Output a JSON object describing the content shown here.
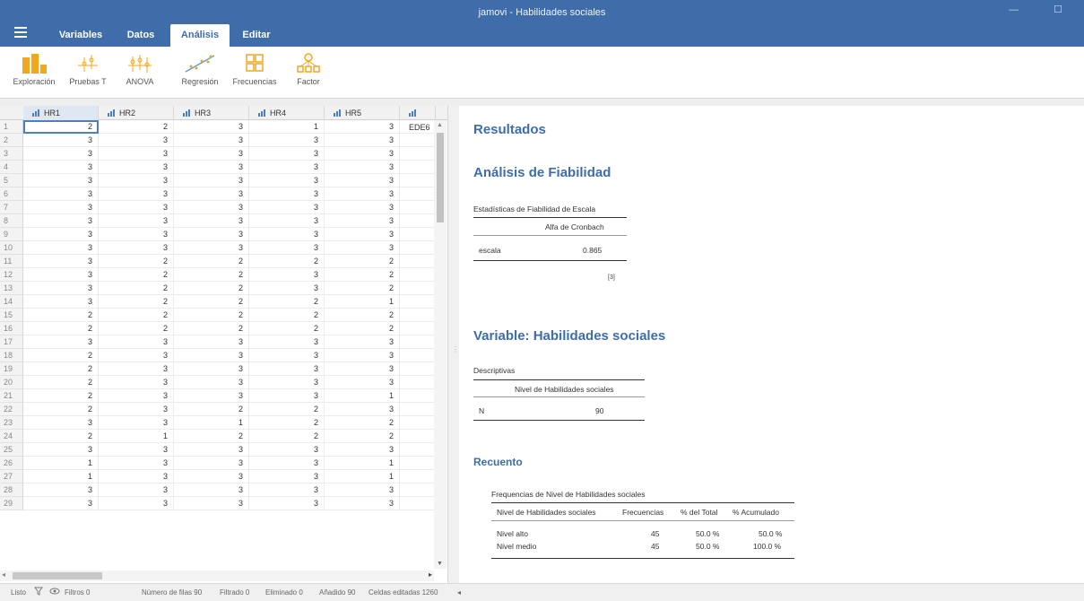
{
  "window": {
    "title": "jamovi - Habilidades sociales",
    "controls": "— ☐"
  },
  "tabs": [
    {
      "label": "Variables"
    },
    {
      "label": "Datos"
    },
    {
      "label": "Análisis"
    },
    {
      "label": "Editar"
    }
  ],
  "active_tab": "Análisis",
  "ribbon": {
    "exploracion": "Exploración",
    "pruebas_t": "Pruebas T",
    "anova": "ANOVA",
    "regresion": "Regresión",
    "frecuencias": "Frecuencias",
    "factor": "Factor"
  },
  "sheet": {
    "columns": [
      "HR1",
      "HR2",
      "HR3",
      "HR4",
      "HR5",
      "EDE6"
    ],
    "rows": [
      [
        2,
        2,
        3,
        1,
        3
      ],
      [
        3,
        3,
        3,
        3,
        3
      ],
      [
        3,
        3,
        3,
        3,
        3
      ],
      [
        3,
        3,
        3,
        3,
        3
      ],
      [
        3,
        3,
        3,
        3,
        3
      ],
      [
        3,
        3,
        3,
        3,
        3
      ],
      [
        3,
        3,
        3,
        3,
        3
      ],
      [
        3,
        3,
        3,
        3,
        3
      ],
      [
        3,
        3,
        3,
        3,
        3
      ],
      [
        3,
        3,
        3,
        3,
        3
      ],
      [
        3,
        2,
        2,
        2,
        2
      ],
      [
        3,
        2,
        2,
        3,
        2
      ],
      [
        3,
        2,
        2,
        3,
        2
      ],
      [
        3,
        2,
        2,
        2,
        1
      ],
      [
        2,
        2,
        2,
        2,
        2
      ],
      [
        2,
        2,
        2,
        2,
        2
      ],
      [
        3,
        3,
        3,
        3,
        3
      ],
      [
        2,
        3,
        3,
        3,
        3
      ],
      [
        2,
        3,
        3,
        3,
        3
      ],
      [
        2,
        3,
        3,
        3,
        3
      ],
      [
        2,
        3,
        3,
        3,
        1
      ],
      [
        2,
        3,
        2,
        2,
        3
      ],
      [
        3,
        3,
        1,
        2,
        2
      ],
      [
        2,
        1,
        2,
        2,
        2
      ],
      [
        3,
        3,
        3,
        3,
        3
      ],
      [
        1,
        3,
        3,
        3,
        1
      ],
      [
        1,
        3,
        3,
        3,
        1
      ],
      [
        3,
        3,
        3,
        3,
        3
      ],
      [
        3,
        3,
        3,
        3,
        3
      ]
    ]
  },
  "results": {
    "title": "Resultados",
    "reliability": {
      "heading": "Análisis de Fiabilidad",
      "table_title": "Estadísticas de Fiabilidad de Escala",
      "col_header": "Alfa de Cronbach",
      "row_label": "escala",
      "value": "0.865",
      "note": "[3]"
    },
    "variable": {
      "heading": "Variable: Habilidades sociales",
      "table_title": "Descriptivas",
      "col_header": "Nivel de Habilidades sociales",
      "row_label": "N",
      "value": "90"
    },
    "count": {
      "heading": "Recuento",
      "table_title": "Frequencias de Nivel de Habilidades sociales",
      "headers": [
        "Nivel de Habilidades sociales",
        "Frecuencias",
        "% del Total",
        "% Acumulado"
      ],
      "rows": [
        [
          "Nivel alto",
          "45",
          "50.0 %",
          "50.0 %"
        ],
        [
          "Nivel medio",
          "45",
          "50.0 %",
          "100.0 %"
        ]
      ]
    }
  },
  "status": {
    "ready": "Listo",
    "filters": "Filtros 0",
    "row_count": "Número de filas 90",
    "filtered": "Filtrado 0",
    "deleted": "Eliminado 0",
    "added": "Añadido 90",
    "edited": "Celdas editadas 1260"
  },
  "colors": {
    "brand": "#3e6da9",
    "accent_orange": "#f0a91e"
  }
}
